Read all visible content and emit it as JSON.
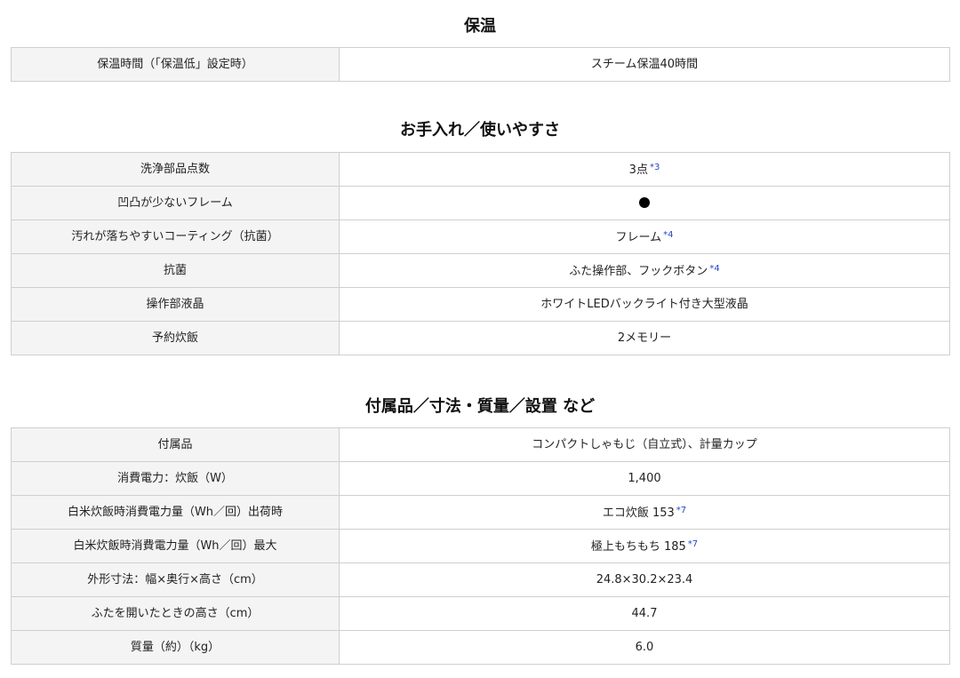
{
  "sections": [
    {
      "title": "保温",
      "rows": [
        {
          "label": "保温時間（「保温低」設定時）",
          "value": "スチーム保温40時間",
          "note": ""
        }
      ]
    },
    {
      "title": "お手入れ／使いやすさ",
      "rows": [
        {
          "label": "洗浄部品点数",
          "value": "3点",
          "note": "*3"
        },
        {
          "label": "凹凸が少ないフレーム",
          "value": "",
          "note": "",
          "icon": "filled-circle"
        },
        {
          "label": "汚れが落ちやすいコーティング（抗菌）",
          "value": "フレーム",
          "note": "*4"
        },
        {
          "label": "抗菌",
          "value": "ふた操作部、フックボタン",
          "note": "*4"
        },
        {
          "label": "操作部液晶",
          "value": "ホワイトLEDバックライト付き大型液晶",
          "note": ""
        },
        {
          "label": "予約炊飯",
          "value": "2メモリー",
          "note": ""
        }
      ]
    },
    {
      "title": "付属品／寸法・質量／設置 など",
      "rows": [
        {
          "label": "付属品",
          "value": "コンパクトしゃもじ（自立式）、計量カップ",
          "note": ""
        },
        {
          "label": "消費電力：炊飯（W）",
          "value": "1,400",
          "note": ""
        },
        {
          "label": "白米炊飯時消費電力量（Wh／回）出荷時",
          "value": "エコ炊飯 153",
          "note": "*7"
        },
        {
          "label": "白米炊飯時消費電力量（Wh／回）最大",
          "value": "極上もちもち 185",
          "note": "*7"
        },
        {
          "label": "外形寸法：幅×奥行×高さ（cm）",
          "value": "24.8×30.2×23.4",
          "note": ""
        },
        {
          "label": "ふたを開いたときの高さ（cm）",
          "value": "44.7",
          "note": ""
        },
        {
          "label": "質量（約）（kg）",
          "value": "6.0",
          "note": ""
        }
      ]
    }
  ]
}
